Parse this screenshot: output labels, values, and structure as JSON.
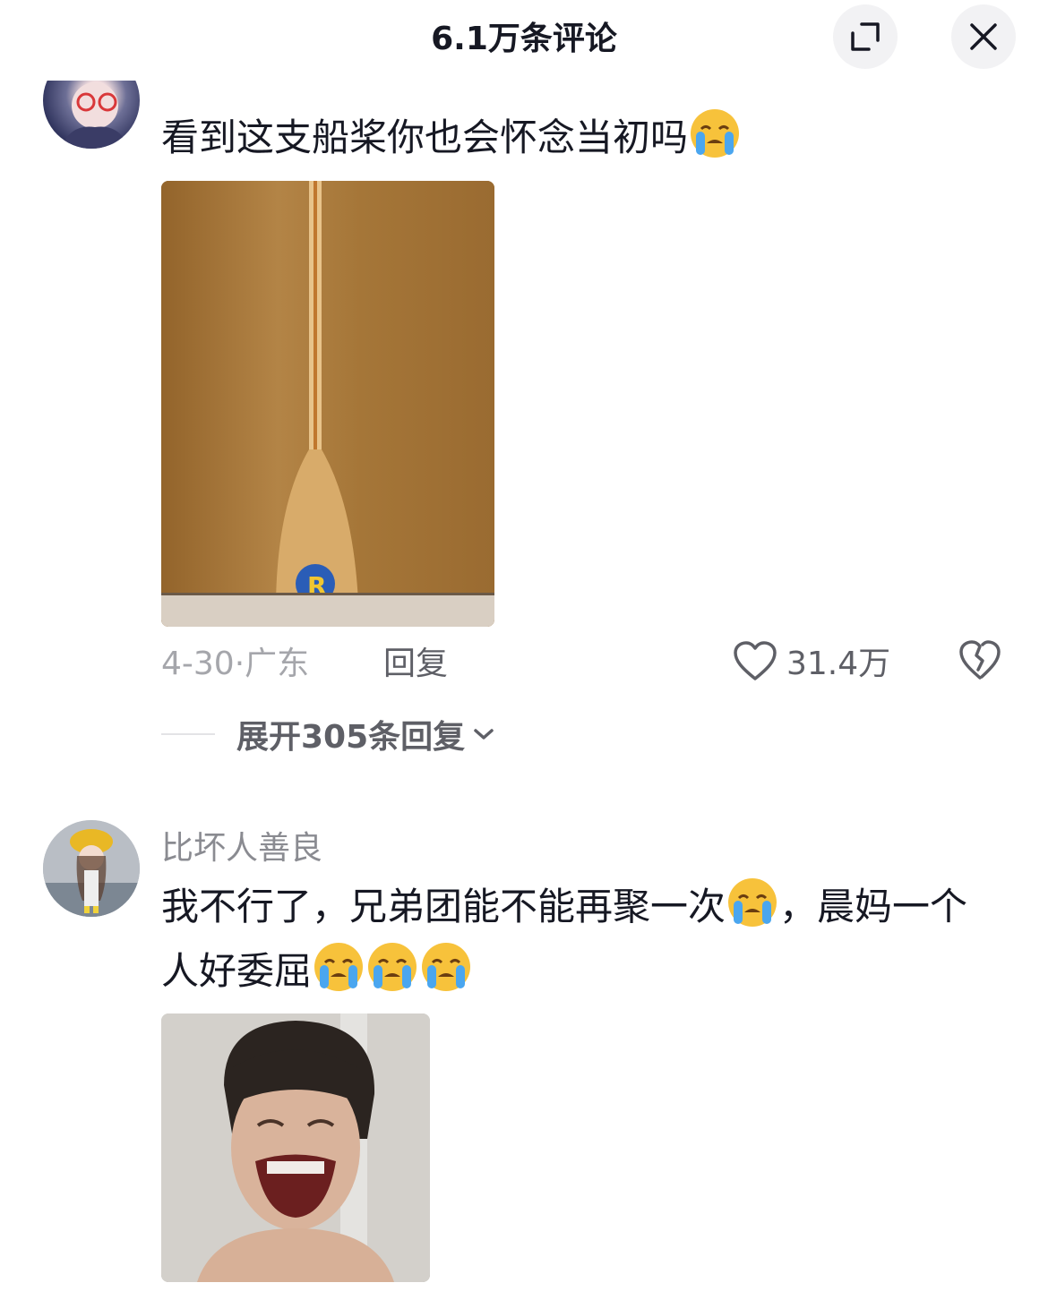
{
  "header": {
    "title": "6.1万条评论",
    "expand_icon": "expand-icon",
    "close_icon": "close-icon"
  },
  "comments": [
    {
      "username": "",
      "text": "看到这支船桨你也会怀念当初吗",
      "emoji": "loudly-crying-face",
      "image": "signed-paddle-photo",
      "date_location": "4-30·广东",
      "reply_label": "回复",
      "like_count": "31.4万",
      "expand_replies": "展开305条回复"
    },
    {
      "username": "比坏人善良",
      "text_part1": "我不行了，兄弟团能不能再聚一次",
      "text_part2": "，晨妈一个人好委屈",
      "emoji": "loudly-crying-face",
      "image": "crying-person-photo"
    }
  ],
  "colors": {
    "primary_text": "#161823",
    "secondary_text": "#8a8b91",
    "meta_text": "#a5a6ab",
    "button_bg": "#f2f2f4"
  }
}
